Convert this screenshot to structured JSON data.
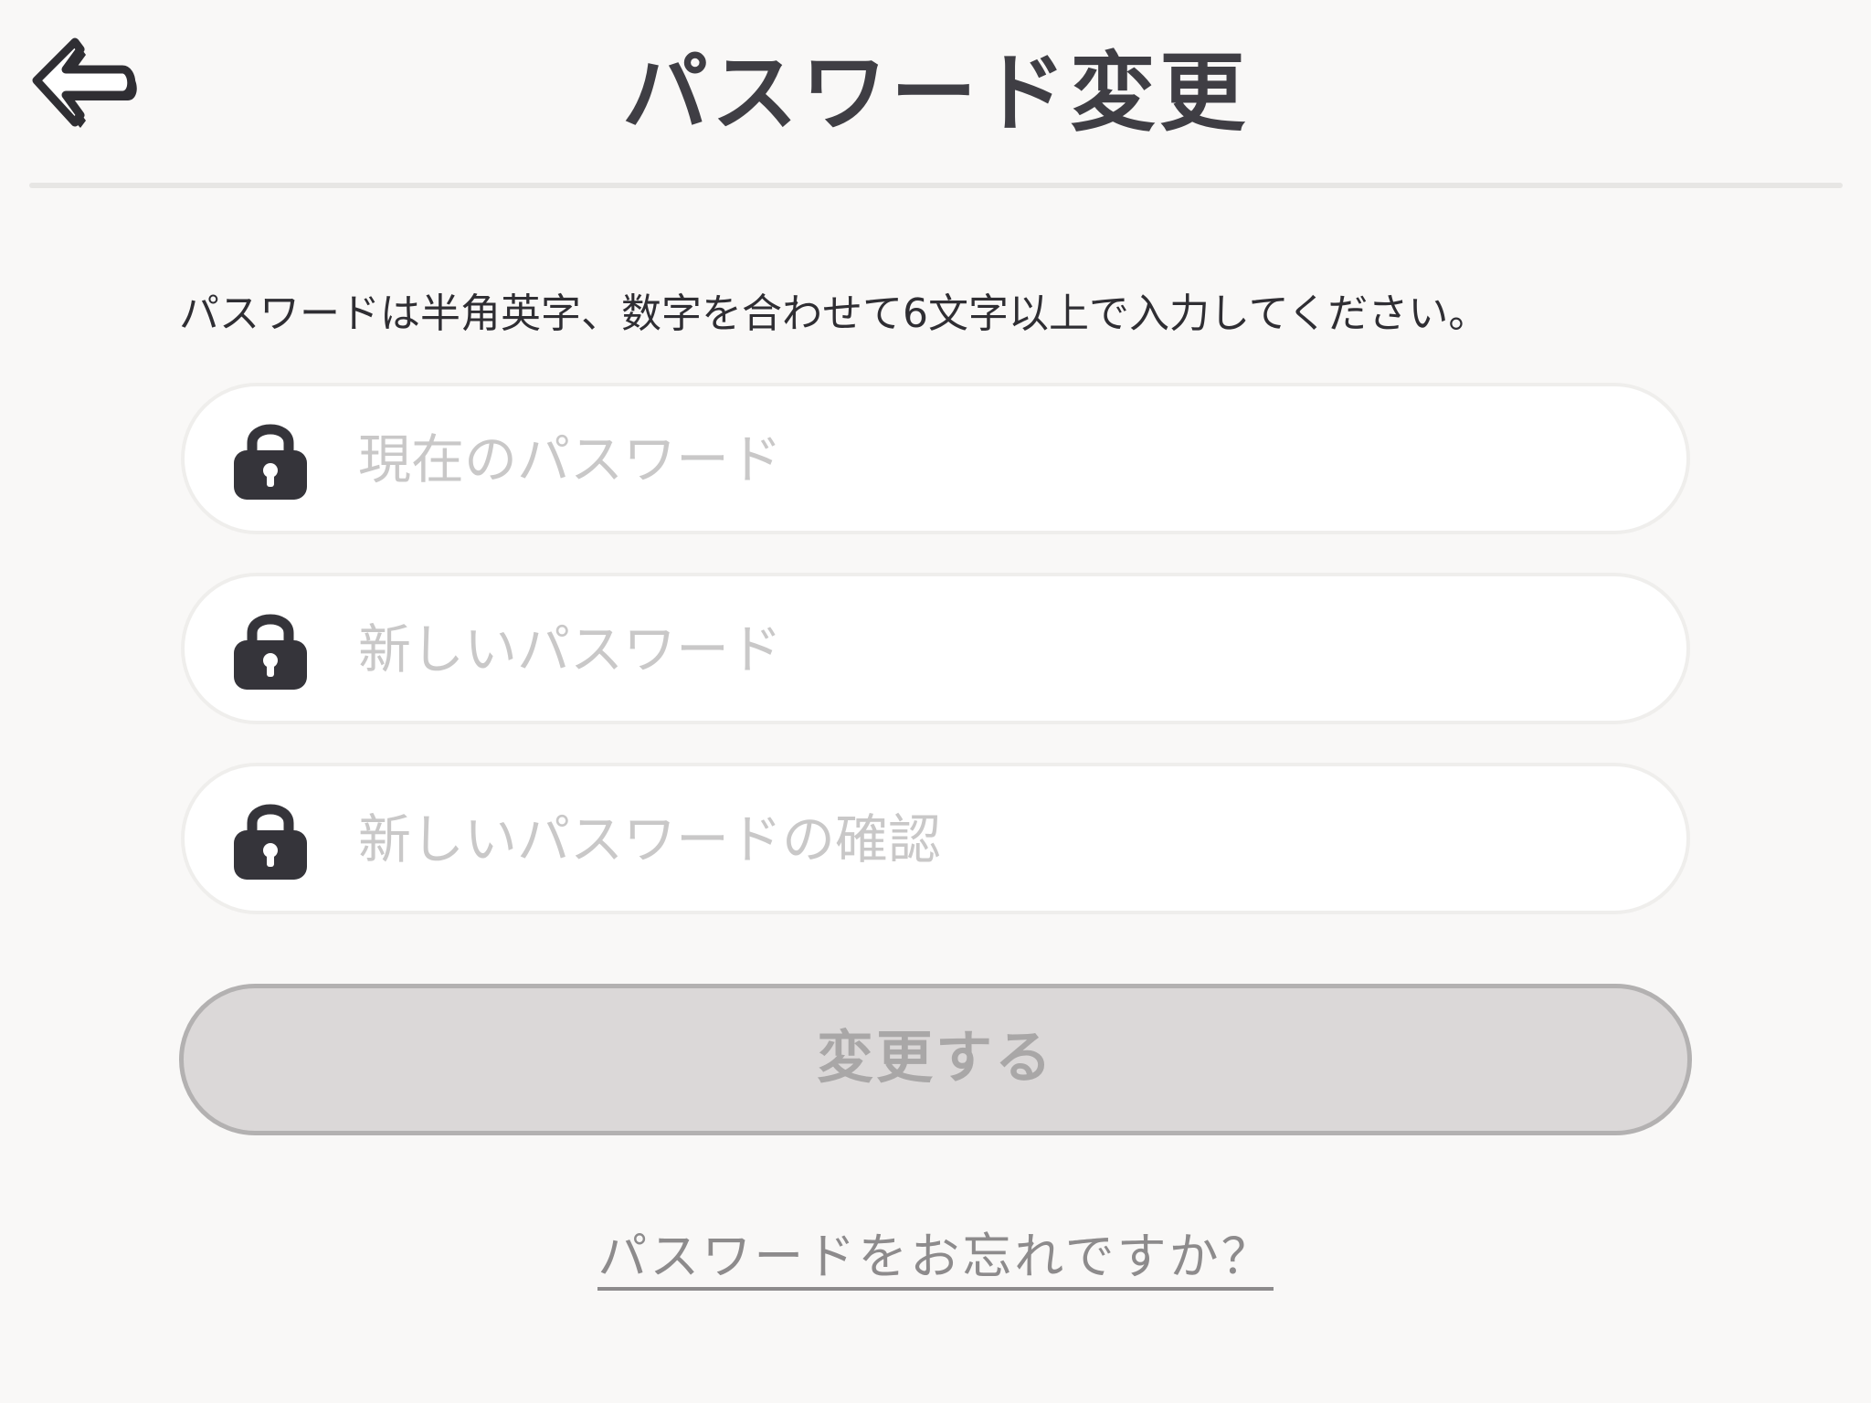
{
  "header": {
    "back_icon": "back-arrow-icon",
    "title": "パスワード変更"
  },
  "instruction": "パスワードは半角英字、数字を合わせて6文字以上で入力してください。",
  "fields": {
    "current_password": {
      "icon": "lock-icon",
      "placeholder": "現在のパスワード",
      "value": ""
    },
    "new_password": {
      "icon": "lock-icon",
      "placeholder": "新しいパスワード",
      "value": ""
    },
    "confirm_password": {
      "icon": "lock-icon",
      "placeholder": "新しいパスワードの確認",
      "value": ""
    }
  },
  "submit_button": {
    "label": "変更する",
    "state": "disabled"
  },
  "forgot_link": {
    "label": "パスワードをお忘れですか？"
  },
  "colors": {
    "background": "#f9f8f7",
    "text_dark": "#3e3d43",
    "placeholder": "#c9c8c8",
    "button_disabled_bg": "#dbd8d8",
    "button_disabled_text": "#a9a7a7",
    "link": "#8d8b8c"
  }
}
